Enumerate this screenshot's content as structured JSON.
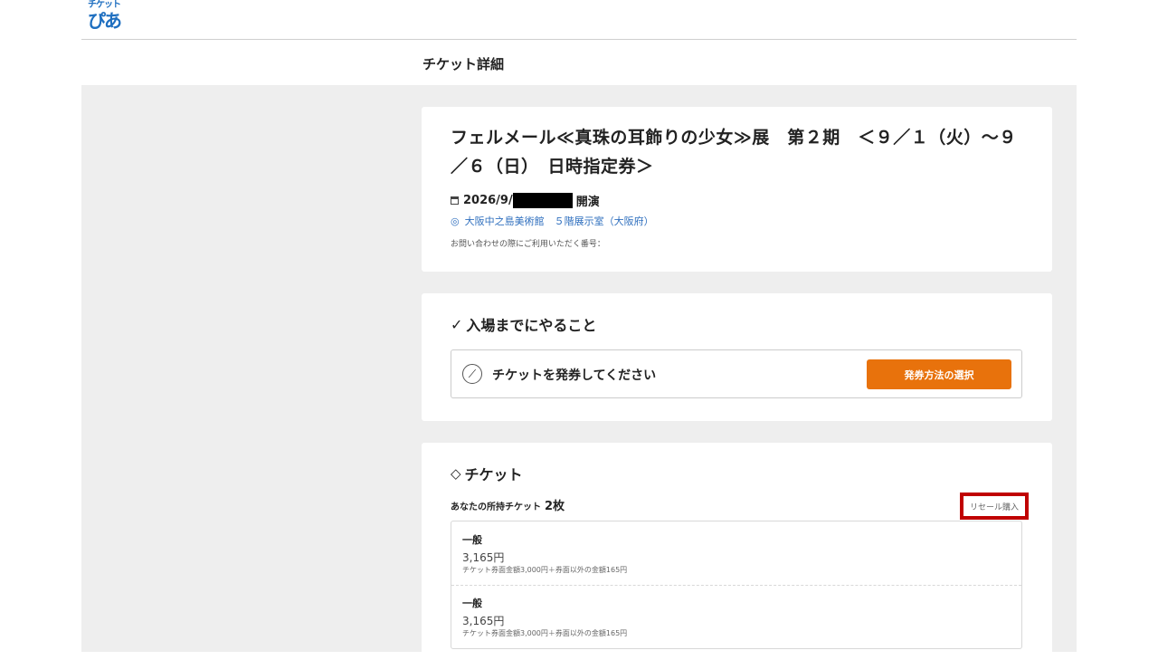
{
  "header": {
    "logo_top": "チケット",
    "logo_main": "ぴあ",
    "page_title": "チケット詳細"
  },
  "event": {
    "title": "フェルメール≪真珠の耳飾りの少女≫展　第２期　＜９／１（火）～９／６（日）　日時指定券＞",
    "date_prefix": "2026/9/",
    "date_suffix": "開演",
    "venue": "大阪中之島美術館　５階展示室（大阪府）",
    "inquiry_label": "お問い合わせの際にご利用いただく番号："
  },
  "todo": {
    "heading": "入場までにやること",
    "item_text": "チケットを発券してください",
    "button_label": "発券方法の選択"
  },
  "tickets": {
    "heading": "チケット",
    "owned_label": "あなたの所持チケット",
    "owned_count": "2枚",
    "resale_label": "リセール購入",
    "items": [
      {
        "type": "一般",
        "price": "3,165円",
        "note": "チケット券面金額3,000円＋券面以外の金額165円"
      },
      {
        "type": "一般",
        "price": "3,165円",
        "note": "チケット券面金額3,000円＋券面以外の金額165円"
      }
    ]
  },
  "colors": {
    "accent_button": "#e8720c",
    "venue_link": "#2f6fbe",
    "highlight_box": "#c00000"
  }
}
